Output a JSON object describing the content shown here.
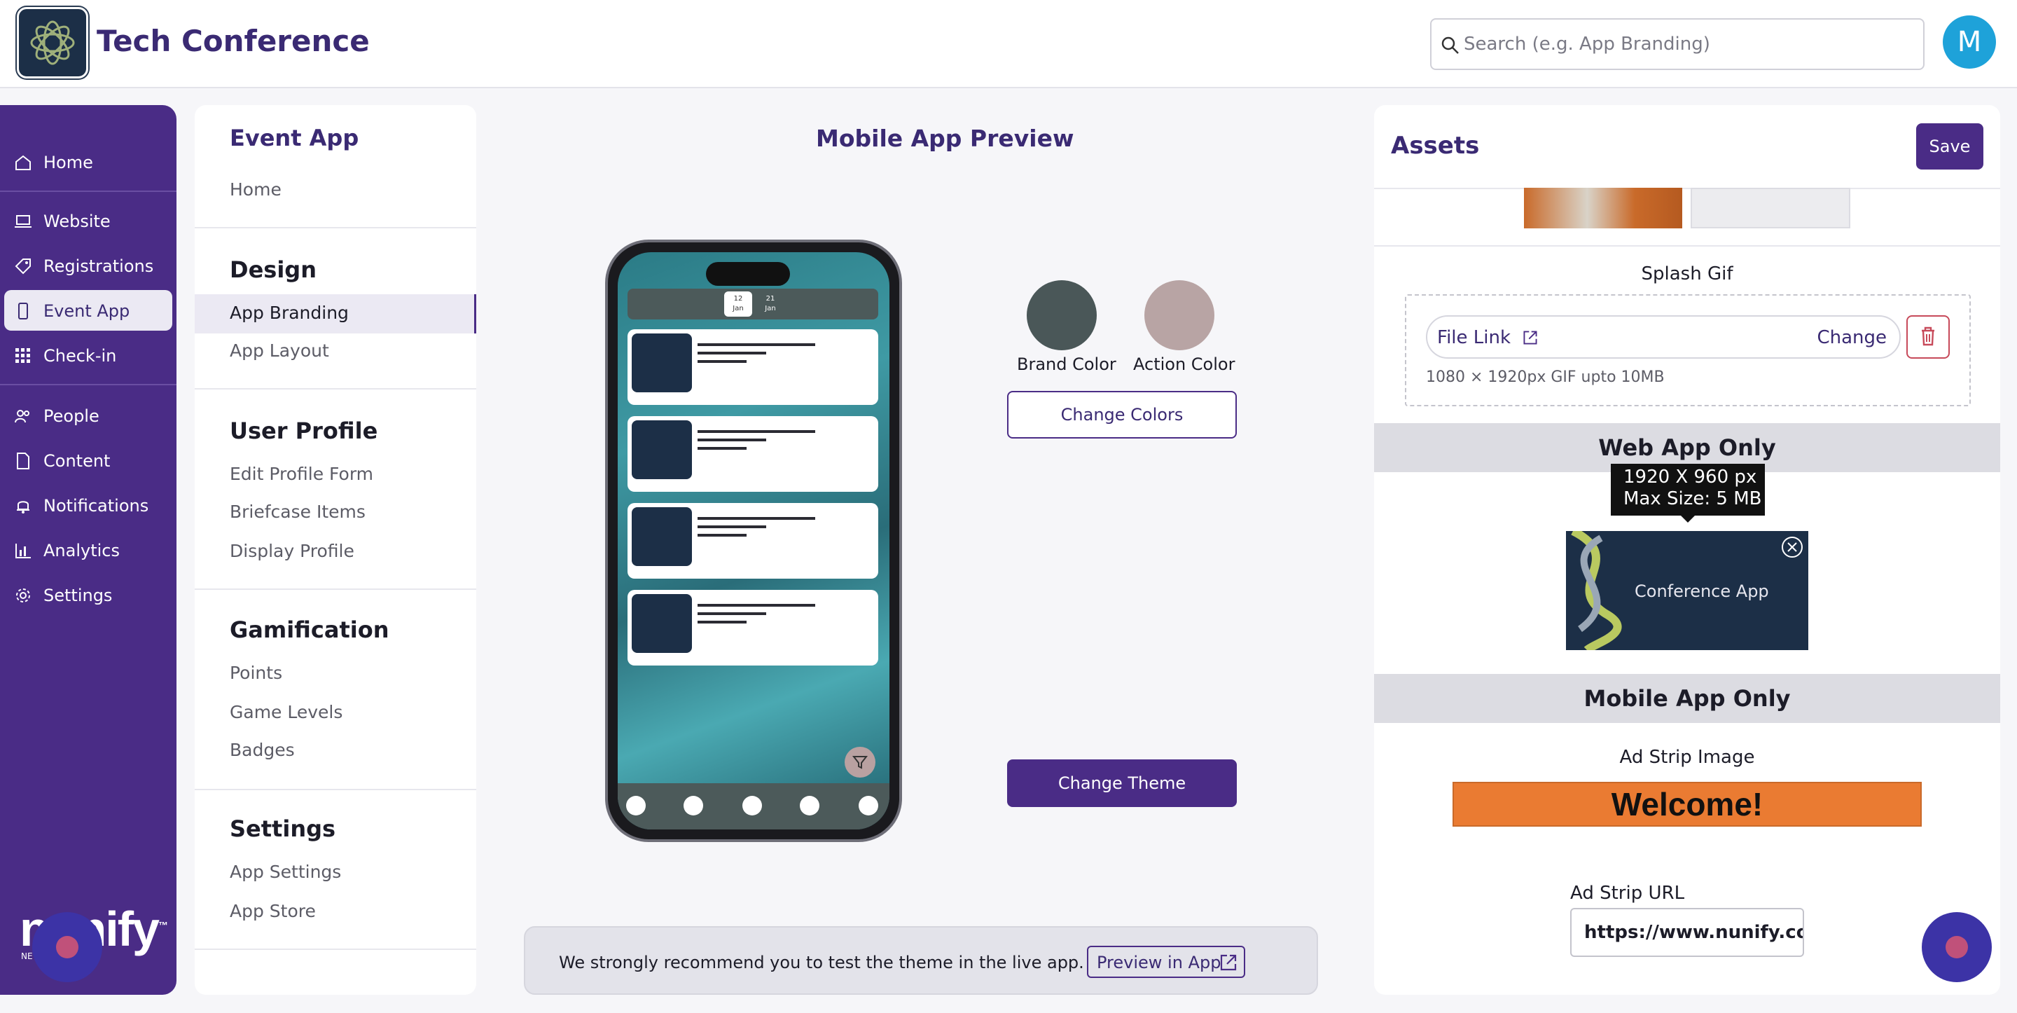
{
  "header": {
    "app_title": "Tech Conference",
    "search_placeholder": "Search (e.g. App Branding)",
    "avatar_initial": "M"
  },
  "sidebar": {
    "items": [
      {
        "label": "Home",
        "icon": "home-icon"
      },
      {
        "label": "Website",
        "icon": "laptop-icon"
      },
      {
        "label": "Registrations",
        "icon": "tag-icon"
      },
      {
        "label": "Event App",
        "icon": "phone-icon"
      },
      {
        "label": "Check-in",
        "icon": "grid-icon"
      },
      {
        "label": "People",
        "icon": "people-icon"
      },
      {
        "label": "Content",
        "icon": "document-icon"
      },
      {
        "label": "Notifications",
        "icon": "bell-icon"
      },
      {
        "label": "Analytics",
        "icon": "bar-chart-icon"
      },
      {
        "label": "Settings",
        "icon": "gear-icon"
      }
    ],
    "brand_text": "nunify",
    "brand_mark": "™",
    "brand_sub": "NE"
  },
  "menu": {
    "section_title": "Event App",
    "home": "Home",
    "design": {
      "heading": "Design",
      "items": [
        "App Branding",
        "App Layout"
      ]
    },
    "user_profile": {
      "heading": "User Profile",
      "items": [
        "Edit Profile Form",
        "Briefcase Items",
        "Display Profile"
      ]
    },
    "gamification": {
      "heading": "Gamification",
      "items": [
        "Points",
        "Game Levels",
        "Badges"
      ]
    },
    "settings": {
      "heading": "Settings",
      "items": [
        "App Settings",
        "App Store"
      ]
    }
  },
  "preview": {
    "title": "Mobile App Preview",
    "dates": [
      {
        "day": "12",
        "month": "Jan"
      },
      {
        "day": "21",
        "month": "Jan"
      }
    ],
    "brand_color": {
      "label": "Brand Color",
      "hex": "#4a5758"
    },
    "action_color": {
      "label": "Action Color",
      "hex": "#b8a4a4"
    },
    "change_colors": "Change Colors",
    "change_theme": "Change Theme",
    "notice": "We strongly recommend you to test the theme in the live app.",
    "preview_in_app": "Preview in App"
  },
  "assets": {
    "title": "Assets",
    "save": "Save",
    "splash_gif": {
      "label": "Splash Gif",
      "file_link": "File Link",
      "change": "Change",
      "hint": "1080 × 1920px GIF upto 10MB"
    },
    "web_app_only": "Web App Only",
    "tooltip_line1": "1920 X 960 px",
    "tooltip_line2": "Max Size: 5 MB",
    "banner_text": "Conference App",
    "mobile_app_only": "Mobile App Only",
    "ad_strip": {
      "label": "Ad Strip Image",
      "text": "Welcome!"
    },
    "ad_strip_url": {
      "label": "Ad Strip URL",
      "value": "https://www.nunify.com"
    }
  },
  "colors": {
    "primary": "#4a2c86",
    "accent_blue": "#1ea2d9",
    "strip_orange": "#ea7b32"
  }
}
